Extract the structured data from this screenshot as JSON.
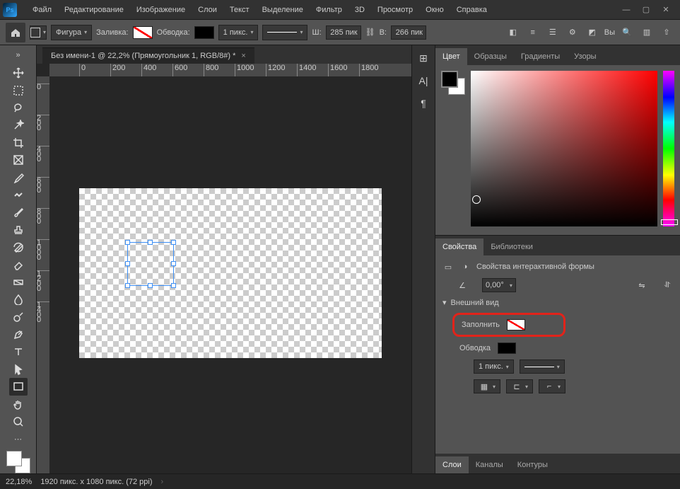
{
  "menu": {
    "file": "Файл",
    "edit": "Редактирование",
    "image": "Изображение",
    "layer": "Слои",
    "type": "Текст",
    "select": "Выделение",
    "filter": "Фильтр",
    "three_d": "3D",
    "view": "Просмотр",
    "window": "Окно",
    "help": "Справка"
  },
  "options": {
    "mode": "Фигура",
    "fill_label": "Заливка:",
    "stroke_label": "Обводка:",
    "stroke_width": "1 пикс.",
    "w_label": "Ш:",
    "w_value": "285 пик",
    "h_label": "В:",
    "h_value": "266 пик",
    "more": "Вы"
  },
  "doc": {
    "tab_title": "Без имени-1 @ 22,2% (Прямоугольник 1, RGB/8#) *"
  },
  "ruler_top": [
    "0",
    "200",
    "400",
    "600",
    "800",
    "1000",
    "1200",
    "1400",
    "1600",
    "1800"
  ],
  "ruler_left": [
    "0",
    "200",
    "400",
    "600",
    "800",
    "1000",
    "1200",
    "1400"
  ],
  "panels": {
    "color_tabs": {
      "color": "Цвет",
      "swatches": "Образцы",
      "gradients": "Градиенты",
      "patterns": "Узоры"
    },
    "props_tabs": {
      "properties": "Свойства",
      "libraries": "Библиотеки"
    },
    "props_title": "Свойства интерактивной формы",
    "angle": "0,00°",
    "appearance": "Внешний вид",
    "fill": "Заполнить",
    "stroke": "Обводка",
    "stroke_size": "1 пикс.",
    "layer_tabs": {
      "layers": "Слои",
      "channels": "Каналы",
      "paths": "Контуры"
    }
  },
  "status": {
    "zoom": "22,18%",
    "docinfo": "1920 пикс. x 1080 пикс. (72 ppi)"
  }
}
